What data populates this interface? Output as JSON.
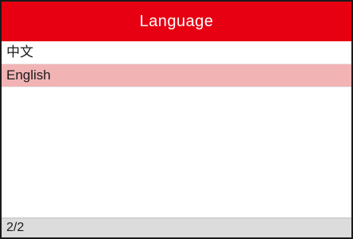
{
  "header": {
    "title": "Language"
  },
  "languages": {
    "items": [
      {
        "label": "中文",
        "selected": false
      },
      {
        "label": "English",
        "selected": true
      }
    ]
  },
  "footer": {
    "page_indicator": "2/2"
  },
  "colors": {
    "title_bar": "#e60012",
    "selected_row": "#f2b3b5",
    "status_bar": "#dcdcdc"
  }
}
